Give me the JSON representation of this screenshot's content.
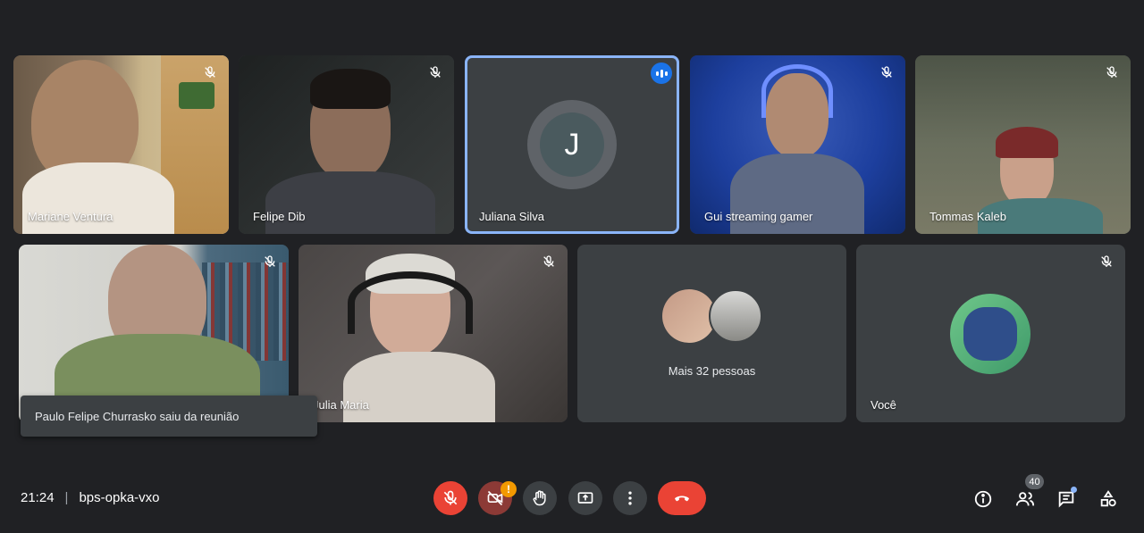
{
  "meeting": {
    "time": "21:24",
    "code": "bps-opka-vxo"
  },
  "participants": [
    {
      "name": "Mariane Ventura"
    },
    {
      "name": "Felipe Dib"
    },
    {
      "name": "Juliana Silva",
      "initial": "J"
    },
    {
      "name": "Gui streaming gamer"
    },
    {
      "name": "Tommas Kaleb"
    },
    {
      "name": "Paulo Felipe Churrasko"
    },
    {
      "name": "Julia Maria"
    }
  ],
  "others_tile": {
    "label": "Mais 32 pessoas"
  },
  "self_tile": {
    "name": "Você"
  },
  "toast": {
    "message": "Paulo Felipe Churrasko saiu da reunião"
  },
  "controls": {
    "mic": "mic-off-icon",
    "camera": "camera-off-icon",
    "camera_warning": "!",
    "raise_hand": "hand-icon",
    "present": "present-icon",
    "more": "more-vert-icon",
    "end_call": "end-call-icon"
  },
  "right_panel": {
    "info": "info-icon",
    "people_count": "40",
    "chat": "chat-icon",
    "activities": "activities-icon"
  },
  "colors": {
    "background": "#202124",
    "tile": "#3c4043",
    "danger": "#ea4335",
    "accent": "#8ab4f8"
  }
}
